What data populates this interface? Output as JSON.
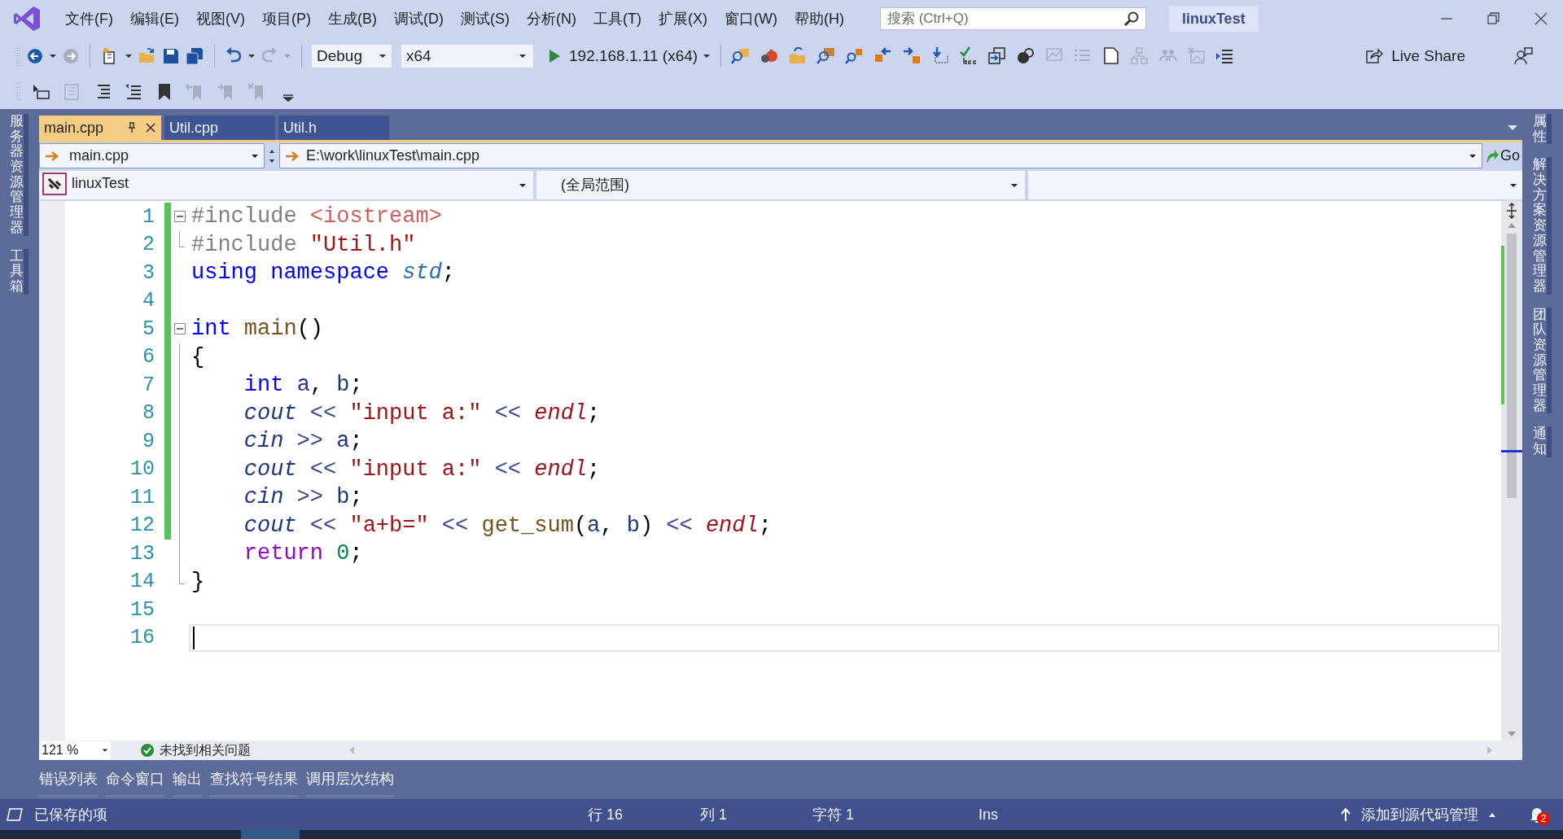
{
  "menu": [
    "文件(F)",
    "编辑(E)",
    "视图(V)",
    "项目(P)",
    "生成(B)",
    "调试(D)",
    "测试(S)",
    "分析(N)",
    "工具(T)",
    "扩展(X)",
    "窗口(W)",
    "帮助(H)"
  ],
  "search": {
    "placeholder": "搜索 (Ctrl+Q)"
  },
  "solution_name": "linuxTest",
  "toolbar": {
    "configuration": "Debug",
    "platform": "x64",
    "run_target": "192.168.1.11 (x64)",
    "live_share": "Live Share"
  },
  "left_panels": [
    "服务器资源管理器",
    "工具箱"
  ],
  "right_panels": [
    "属性",
    "解决方案资源管理器",
    "团队资源管理器",
    "通知"
  ],
  "tabs": [
    {
      "label": "main.cpp",
      "selected": true
    },
    {
      "label": "Util.cpp",
      "selected": false
    },
    {
      "label": "Util.h",
      "selected": false
    }
  ],
  "nav": {
    "file": "main.cpp",
    "path": "E:\\work\\linuxTest\\main.cpp",
    "go": "Go",
    "project": "linuxTest",
    "scope": "(全局范围)"
  },
  "editor": {
    "lines": [
      {
        "number": "1",
        "changed": true,
        "fold_marker": true,
        "in_region": false,
        "current": false,
        "tokens": [
          {
            "text": "#include ",
            "kind": "preproc"
          },
          {
            "text": "<iostream>",
            "kind": "header"
          }
        ]
      },
      {
        "number": "2",
        "changed": true,
        "fold_marker": false,
        "in_region": true,
        "current": false,
        "tokens": [
          {
            "text": "#include ",
            "kind": "preproc"
          },
          {
            "text": "\"Util.h\"",
            "kind": "string"
          }
        ]
      },
      {
        "number": "3",
        "changed": true,
        "fold_marker": false,
        "in_region": false,
        "current": false,
        "tokens": [
          {
            "text": "using namespace ",
            "kind": "keyword"
          },
          {
            "text": "std",
            "kind": "namespace"
          },
          {
            "text": ";",
            "kind": "plain"
          }
        ]
      },
      {
        "number": "4",
        "changed": true,
        "fold_marker": false,
        "in_region": false,
        "current": false
      },
      {
        "number": "5",
        "changed": true,
        "fold_marker": true,
        "in_region": false,
        "current": false,
        "tokens": [
          {
            "text": "int ",
            "kind": "keyword"
          },
          {
            "text": "main",
            "kind": "function"
          },
          {
            "text": "()",
            "kind": "plain"
          }
        ]
      },
      {
        "number": "6",
        "changed": true,
        "fold_marker": false,
        "in_region": true,
        "current": false,
        "tokens": [
          {
            "text": "{",
            "kind": "plain"
          }
        ]
      },
      {
        "number": "7",
        "changed": true,
        "fold_marker": false,
        "in_region": true,
        "current": false,
        "tokens": [
          {
            "text": "    int ",
            "kind": "keyword"
          },
          {
            "text": "a",
            "kind": "variable"
          },
          {
            "text": ", ",
            "kind": "plain"
          },
          {
            "text": "b",
            "kind": "variable"
          },
          {
            "text": ";",
            "kind": "plain"
          }
        ]
      },
      {
        "number": "8",
        "changed": true,
        "fold_marker": false,
        "in_region": true,
        "current": false,
        "tokens": [
          {
            "text": "    cout",
            "kind": "stream"
          },
          {
            "text": " << ",
            "kind": "operator"
          },
          {
            "text": "\"input a:\"",
            "kind": "string"
          },
          {
            "text": " << ",
            "kind": "operator"
          },
          {
            "text": "endl",
            "kind": "manipulator"
          },
          {
            "text": ";",
            "kind": "plain"
          }
        ]
      },
      {
        "number": "9",
        "changed": true,
        "fold_marker": false,
        "in_region": true,
        "current": false,
        "tokens": [
          {
            "text": "    cin",
            "kind": "stream"
          },
          {
            "text": " >> ",
            "kind": "operator"
          },
          {
            "text": "a",
            "kind": "variable"
          },
          {
            "text": ";",
            "kind": "plain"
          }
        ]
      },
      {
        "number": "10",
        "changed": true,
        "fold_marker": false,
        "in_region": true,
        "current": false,
        "tokens": [
          {
            "text": "    cout",
            "kind": "stream"
          },
          {
            "text": " << ",
            "kind": "operator"
          },
          {
            "text": "\"input a:\"",
            "kind": "string"
          },
          {
            "text": " << ",
            "kind": "operator"
          },
          {
            "text": "endl",
            "kind": "manipulator"
          },
          {
            "text": ";",
            "kind": "plain"
          }
        ]
      },
      {
        "number": "11",
        "changed": true,
        "fold_marker": false,
        "in_region": true,
        "current": false,
        "tokens": [
          {
            "text": "    cin",
            "kind": "stream"
          },
          {
            "text": " >> ",
            "kind": "operator"
          },
          {
            "text": "b",
            "kind": "variable"
          },
          {
            "text": ";",
            "kind": "plain"
          }
        ]
      },
      {
        "number": "12",
        "changed": true,
        "fold_marker": false,
        "in_region": true,
        "current": false,
        "tokens": [
          {
            "text": "    cout",
            "kind": "stream"
          },
          {
            "text": " << ",
            "kind": "operator"
          },
          {
            "text": "\"a+b=\"",
            "kind": "string"
          },
          {
            "text": " << ",
            "kind": "operator"
          },
          {
            "text": "get_sum",
            "kind": "function"
          },
          {
            "text": "(",
            "kind": "plain"
          },
          {
            "text": "a",
            "kind": "variable"
          },
          {
            "text": ", ",
            "kind": "plain"
          },
          {
            "text": "b",
            "kind": "variable"
          },
          {
            "text": ")",
            "kind": "plain"
          },
          {
            "text": " << ",
            "kind": "operator"
          },
          {
            "text": "endl",
            "kind": "manipulator"
          },
          {
            "text": ";",
            "kind": "plain"
          }
        ]
      },
      {
        "number": "13",
        "changed": false,
        "fold_marker": false,
        "in_region": true,
        "current": false,
        "tokens": [
          {
            "text": "    return ",
            "kind": "control"
          },
          {
            "text": "0",
            "kind": "number"
          },
          {
            "text": ";",
            "kind": "plain"
          }
        ]
      },
      {
        "number": "14",
        "changed": false,
        "fold_marker": false,
        "in_region": true,
        "current": false,
        "tokens": [
          {
            "text": "}",
            "kind": "plain"
          }
        ]
      },
      {
        "number": "15",
        "changed": false,
        "fold_marker": false,
        "in_region": false,
        "current": false
      },
      {
        "number": "16",
        "changed": false,
        "fold_marker": false,
        "in_region": false,
        "current": true
      }
    ]
  },
  "editor_status": {
    "zoom": "121 %",
    "issues": "未找到相关问题"
  },
  "bottom_tabs": [
    "错误列表",
    "命令窗口",
    "输出",
    "查找符号结果",
    "调用层次结构"
  ],
  "status_bar": {
    "message": "已保存的项",
    "line": "行 16",
    "column": "列 1",
    "character": "字符 1",
    "mode": "Ins",
    "source_control": "添加到源代码管理",
    "notifications": "2"
  }
}
